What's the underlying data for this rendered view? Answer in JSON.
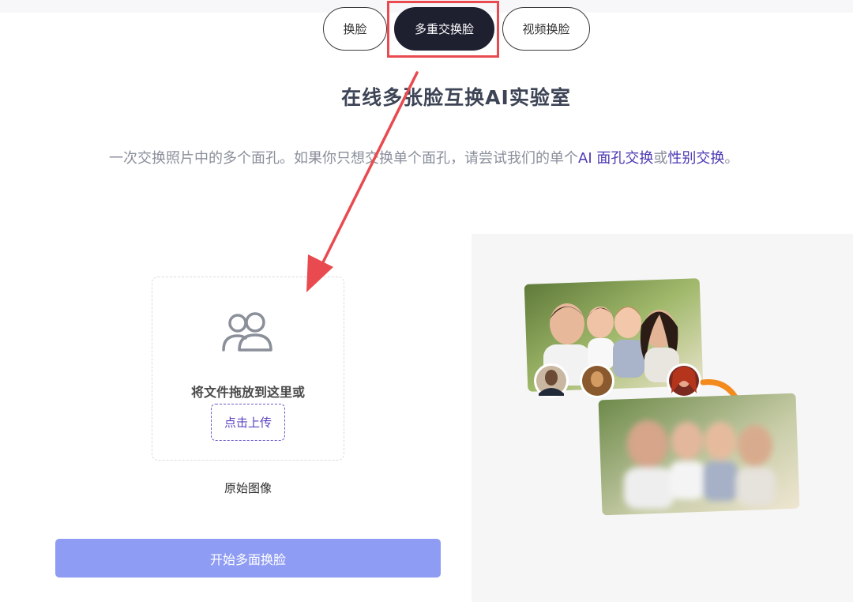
{
  "tabs": [
    {
      "label": "换脸"
    },
    {
      "label": "多重交换脸"
    },
    {
      "label": "视频换脸"
    }
  ],
  "active_tab": "多重交换脸",
  "title": "在线多张脸互换AI实验室",
  "subtitle": {
    "prefix": "一次交换照片中的多个面孔。如果你只想交换单个面孔，请尝试我们的单个",
    "link1": "AI 面孔交换",
    "middle": "或",
    "link2": "性别交换",
    "suffix": "。"
  },
  "upload": {
    "drop_text": "将文件拖放到这里或",
    "button_label": "点击上传",
    "caption": "原始图像"
  },
  "start_button_label": "开始多面换脸",
  "colors": {
    "active_tab_bg": "#1e2030",
    "highlight": "#e84a4f",
    "link": "#4b3ab3",
    "start_button": "#8f9cf4",
    "orange_arrow": "#f28a1e"
  }
}
